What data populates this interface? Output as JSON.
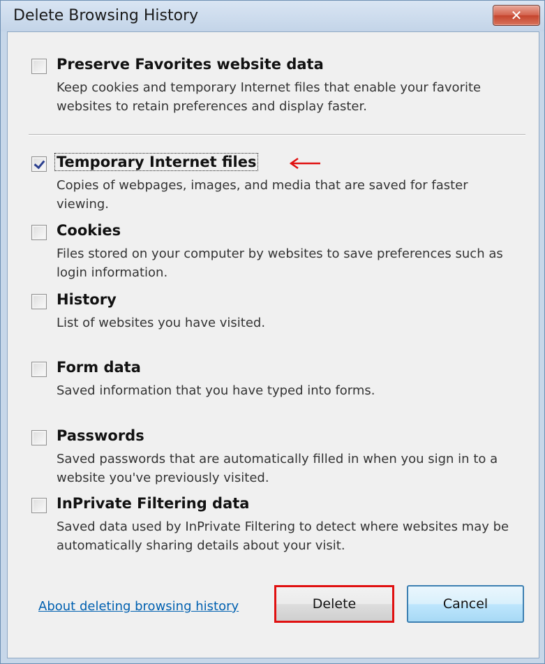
{
  "window": {
    "title": "Delete Browsing History",
    "close_glyph": "✕"
  },
  "options": [
    {
      "label": "Preserve Favorites website data",
      "description": "Keep cookies and temporary Internet files that enable your favorite websites to retain preferences and display faster.",
      "checked": false
    },
    {
      "label": "Temporary Internet files",
      "description": "Copies of webpages, images, and media that are saved for faster viewing.",
      "checked": true
    },
    {
      "label": "Cookies",
      "description": "Files stored on your computer by websites to save preferences such as login information.",
      "checked": false
    },
    {
      "label": "History",
      "description": "List of websites you have visited.",
      "checked": false
    },
    {
      "label": "Form data",
      "description": "Saved information that you have typed into forms.",
      "checked": false
    },
    {
      "label": "Passwords",
      "description": "Saved passwords that are automatically filled in when you sign in to a website you've previously visited.",
      "checked": false
    },
    {
      "label": "InPrivate Filtering data",
      "description": "Saved data used by InPrivate Filtering to detect where websites may be automatically sharing details about your visit.",
      "checked": false
    }
  ],
  "footer": {
    "about_link": "About deleting browsing history",
    "delete_label": "Delete",
    "cancel_label": "Cancel"
  },
  "colors": {
    "annotation_red": "#e01010",
    "link_blue": "#0060b0"
  }
}
